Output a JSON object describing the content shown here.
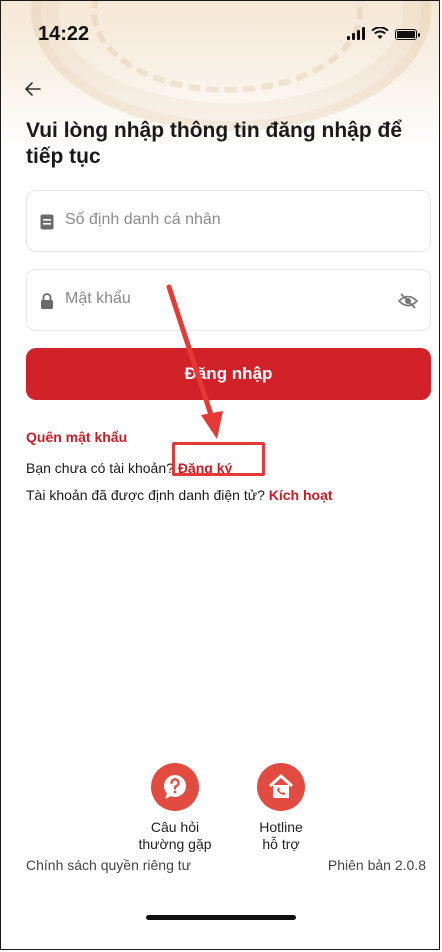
{
  "status_bar": {
    "time": "14:22"
  },
  "header": {
    "back_icon": "arrow-left-icon",
    "title": "Vui lòng nhập thông tin đăng nhập để tiếp tục"
  },
  "form": {
    "id_placeholder": "Số định danh cá nhân",
    "password_placeholder": "Mật khẩu",
    "login_button": "Đăng nhập"
  },
  "links": {
    "forgot_password": "Quên mật khẩu",
    "no_account_text": "Bạn chưa có tài khoản?",
    "register": "Đăng ký",
    "activated_text": "Tài khoản đã được định danh điện tử?",
    "activate": "Kích hoạt"
  },
  "support": {
    "faq_label": [
      "Câu hỏi",
      "thường gặp"
    ],
    "hotline_label": [
      "Hotline",
      "hỗ trợ"
    ]
  },
  "footer": {
    "privacy": "Chính sách quyền riêng tư",
    "version": "Phiên bản 2.0.8"
  },
  "colors": {
    "brand_red": "#d1222a",
    "link_red": "#c81d25",
    "annotation_red": "#e53935"
  }
}
